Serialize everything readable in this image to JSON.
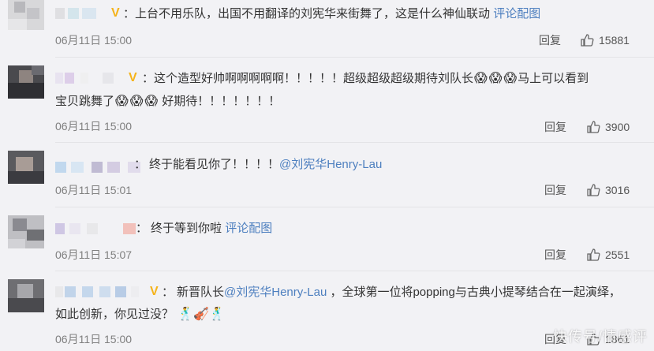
{
  "comments": [
    {
      "text_1": "上台不用乐队，出国不用翻译的刘宪华来街舞了，这是什么神仙联动",
      "link_1": "评论配图",
      "time": "06月11日 15:00",
      "reply": "回复",
      "likes": "15881"
    },
    {
      "text_1": "这个造型好帅啊啊啊啊啊！！！！！超级超级超级期待刘队长",
      "text_2": "马上可以看到",
      "text_3": "宝贝跳舞了",
      "text_4": "好期待！！！！！！！",
      "emoji_a": "😱",
      "emoji_b": "😱",
      "time": "06月11日 15:00",
      "reply": "回复",
      "likes": "3900"
    },
    {
      "text_1": "终于能看见你了！！！！",
      "mention": "@刘宪华Henry-Lau",
      "time": "06月11日 15:01",
      "reply": "回复",
      "likes": "3016"
    },
    {
      "text_1": "终于等到你啦",
      "link_1": "评论配图",
      "time": "06月11日 15:07",
      "reply": "回复",
      "likes": "2551"
    },
    {
      "text_1": "新晋队长",
      "mention": "@刘宪华Henry-Lau",
      "text_2": "，全球第一位将popping与古典小提琴结合在一起演绎，",
      "text_3": "如此创新，你见过没？",
      "emojis": "🕺🎻🕺",
      "time": "06月11日 15:00",
      "reply": "回复",
      "likes": "1861"
    }
  ],
  "icons": {
    "like": "thumbs-up-icon",
    "verified": "verified-v-icon"
  },
  "colors": {
    "link": "#4d7fbf",
    "verified": "#f5b31a",
    "background": "#f2f2f5"
  },
  "watermark": "快传号/情感评"
}
